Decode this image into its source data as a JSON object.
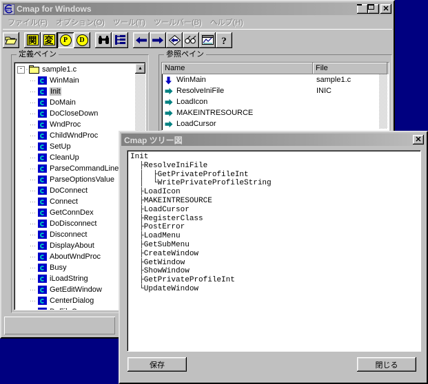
{
  "desktop": {
    "bg_color": "#000080"
  },
  "main_window": {
    "title": "Cmap for Windows",
    "app_icon": "cmap-icon",
    "active": false,
    "title_buttons": [
      {
        "name": "minimize-button",
        "glyph": "_"
      },
      {
        "name": "maximize-button",
        "glyph": "□"
      },
      {
        "name": "close-button",
        "glyph": "✕"
      }
    ],
    "menu": [
      {
        "label": "ファイル(F)"
      },
      {
        "label": "オプション(O)"
      },
      {
        "label": "ツール(T)"
      },
      {
        "label": "ツールバー(B)"
      },
      {
        "label": "ヘルプ(H)"
      }
    ],
    "toolbar": [
      {
        "name": "open-file-button",
        "icon": "open-folder-icon",
        "kind": "folder",
        "pressed": false
      },
      {
        "name": "function-filter-button",
        "icon": "kanji-kan-icon",
        "kind": "kanji",
        "text": "関",
        "pressed": false
      },
      {
        "name": "variable-filter-button",
        "icon": "kanji-hen-icon",
        "kind": "kanji",
        "text": "変",
        "pressed": false
      },
      {
        "name": "prototype-toggle-button",
        "icon": "letter-p-icon",
        "kind": "circle",
        "text": "P",
        "pressed": true
      },
      {
        "name": "define-toggle-button",
        "icon": "letter-d-icon",
        "kind": "circle",
        "text": "D",
        "pressed": false
      },
      {
        "name": "search-button",
        "icon": "binoculars-icon",
        "kind": "binoculars",
        "pressed": false
      },
      {
        "name": "tree-view-button",
        "icon": "tree-list-icon",
        "kind": "treelist",
        "pressed": false
      },
      {
        "name": "back-button",
        "icon": "arrow-left-icon",
        "kind": "arrow-left",
        "pressed": false
      },
      {
        "name": "forward-button",
        "icon": "arrow-right-icon",
        "kind": "arrow-right",
        "pressed": false
      },
      {
        "name": "jump-back-button",
        "icon": "diamond-arrow-left-icon",
        "kind": "diamond",
        "pressed": false
      },
      {
        "name": "view-source-button",
        "icon": "glasses-icon",
        "kind": "glasses",
        "pressed": false
      },
      {
        "name": "chart-button",
        "icon": "chart-window-icon",
        "kind": "chart",
        "pressed": false
      },
      {
        "name": "help-button",
        "icon": "question-mark-icon",
        "kind": "question",
        "pressed": false
      }
    ],
    "definition_pane": {
      "title": "定義ペイン",
      "root": {
        "label": "sample1.c",
        "icon": "folder-icon",
        "expander": "-"
      },
      "selected": "Init",
      "items": [
        "WinMain",
        "Init",
        "DoMain",
        "DoCloseDown",
        "WndProc",
        "ChildWndProc",
        "SetUp",
        "CleanUp",
        "ParseCommandLine",
        "ParseOptionsValue",
        "DoConnect",
        "Connect",
        "GetConnDex",
        "DoDisconnect",
        "Disconnect",
        "DisplayAbout",
        "AboutWndProc",
        "Busy",
        "iLoadString",
        "GetEditWindow",
        "CenterDialog",
        "DoFileO"
      ]
    },
    "reference_pane": {
      "title": "参照ペイン",
      "columns": [
        "Name",
        "File"
      ],
      "rows": [
        {
          "name": "WinMain",
          "file": "sample1.c",
          "icon": "arrow-down-blue-icon"
        },
        {
          "name": "ResolveIniFile",
          "file": "INIC",
          "icon": "arrow-right-green-icon"
        },
        {
          "name": "LoadIcon",
          "file": "",
          "icon": "arrow-right-green-icon"
        },
        {
          "name": "MAKEINTRESOURCE",
          "file": "",
          "icon": "arrow-right-green-icon"
        },
        {
          "name": "LoadCursor",
          "file": "",
          "icon": "arrow-right-green-icon"
        }
      ]
    }
  },
  "dialog": {
    "title": "Cmap ツリー図",
    "close_button": {
      "name": "dialog-close-button",
      "glyph": "✕"
    },
    "tree_text": "Init\n  ├ResolveIniFile\n  │  ├GetPrivateProfileInt\n  │  └WritePrivateProfileString\n  ├LoadIcon\n  ├MAKEINTRESOURCE\n  ├LoadCursor\n  ├RegisterClass\n  ├PostError\n  ├LoadMenu\n  ├GetSubMenu\n  ├CreateWindow\n  ├GetWindow\n  ├ShowWindow\n  ├GetPrivateProfileInt\n  └UpdateWindow",
    "buttons": {
      "save_label": "保存",
      "close_label": "閉じる"
    }
  }
}
